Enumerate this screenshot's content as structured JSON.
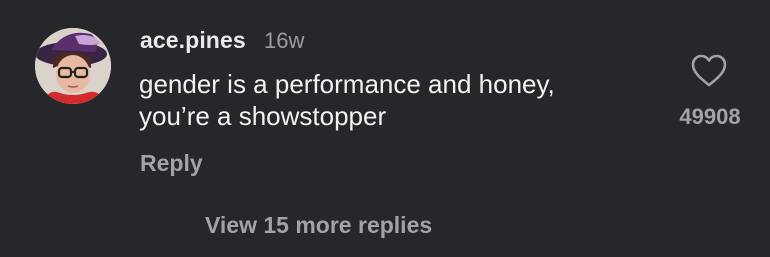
{
  "comment": {
    "username": "ace.pines",
    "age": "16w",
    "text_line1": "gender is a performance and honey,",
    "text_line2": "you’re a showstopper",
    "reply_label": "Reply",
    "like_icon": "heart-outline-icon",
    "like_count": "49908"
  },
  "replies": {
    "view_more_label": "View 15 more replies"
  },
  "colors": {
    "background": "#26272b",
    "primary_text": "#f2f2f4",
    "secondary_text": "#a2a3aa"
  }
}
